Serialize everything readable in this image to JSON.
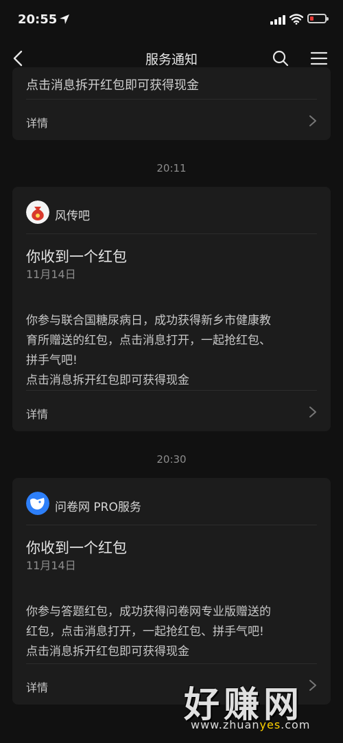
{
  "status_bar": {
    "time": "20:55",
    "icons": [
      "location-arrow-icon",
      "signal-icon",
      "wifi-icon",
      "battery-low-icon"
    ],
    "battery_color": "#e53935"
  },
  "nav": {
    "title": "服务通知",
    "icons": [
      "back-arrow-icon",
      "search-icon",
      "menu-icon"
    ]
  },
  "top_card": {
    "last_line": "点击消息拆开红包即可获得现金",
    "detail_label": "详情"
  },
  "messages": [
    {
      "timestamp": "20:11",
      "app_name": "风传吧",
      "app_icon": "money-bag-icon",
      "title": "你收到一个红包",
      "date": "11月14日",
      "body_lines": [
        "你参与联合国糖尿病日，成功获得新乡市健康教",
        "育所赠送的红包，点击消息打开，一起抢红包、",
        "拼手气吧!",
        "点击消息拆开红包即可获得现金"
      ],
      "detail_label": "详情"
    },
    {
      "timestamp": "20:30",
      "app_name": "问卷网 PRO服务",
      "app_icon": "wenjuan-fox-icon",
      "title": "你收到一个红包",
      "date": "11月14日",
      "body_lines": [
        "你参与答题红包，成功获得问卷网专业版赠送的",
        "红包，点击消息打开，一起抢红包、拼手气吧!",
        "点击消息拆开红包即可获得现金"
      ],
      "detail_label": "详情"
    }
  ],
  "watermark": {
    "text": "好赚网",
    "url_prefix": "www.zhuan",
    "url_highlight": "yes",
    "url_suffix": ".com"
  },
  "colors": {
    "background": "#111111",
    "card": "#1c1c1c",
    "money_bag_red": "#d8392b",
    "wenjuan_blue": "#2d7ff9"
  }
}
